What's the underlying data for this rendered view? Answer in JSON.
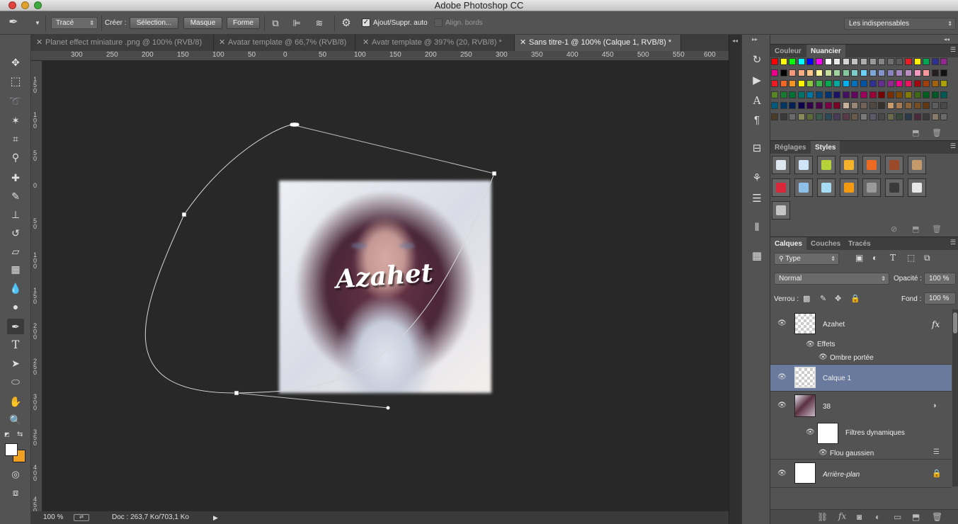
{
  "app": {
    "title": "Adobe Photoshop CC"
  },
  "options": {
    "tool_mode": "Tracé",
    "create_label": "Créer :",
    "selection_btn": "Sélection...",
    "mask_btn": "Masque",
    "shape_btn": "Forme",
    "auto_add": "Ajout/Suppr. auto",
    "align_edges": "Align. bords",
    "workspace": "Les indispensables"
  },
  "tabs": [
    {
      "label": "Planet effect miniature .png @ 100% (RVB/8)"
    },
    {
      "label": "Avatar template @ 66,7% (RVB/8)"
    },
    {
      "label": "Avatr template @ 397% (20, RVB/8) *"
    },
    {
      "label": "Sans titre-1 @ 100% (Calque 1, RVB/8) *"
    }
  ],
  "ruler": {
    "top": [
      "300",
      "250",
      "200",
      "150",
      "100",
      "50",
      "0",
      "50",
      "100",
      "150",
      "200",
      "250",
      "300",
      "350",
      "400",
      "450",
      "500",
      "550",
      "600"
    ],
    "left": [
      "150",
      "100",
      "50",
      "0",
      "50",
      "100",
      "150",
      "200",
      "250",
      "300",
      "350",
      "400",
      "450"
    ]
  },
  "canvas": {
    "watermark": "Azahet"
  },
  "status": {
    "zoom": "100 %",
    "doc": "Doc : 263,7 Ko/703,1 Ko"
  },
  "panels": {
    "color_tab": "Couleur",
    "swatches_tab": "Nuancier",
    "adjust_tab": "Réglages",
    "styles_tab": "Styles",
    "layers_tab": "Calques",
    "channels_tab": "Couches",
    "paths_tab": "Tracés"
  },
  "layers": {
    "filter_kind": "Type",
    "blend_mode": "Normal",
    "opacity_label": "Opacité :",
    "opacity": "100 %",
    "lock_label": "Verrou :",
    "fill_label": "Fond :",
    "fill": "100 %",
    "items": [
      {
        "name": "Azahet",
        "fx": "fx",
        "effects": "Effets",
        "effect1": "Ombre portée"
      },
      {
        "name": "Calque 1"
      },
      {
        "name": "38",
        "smart_filters": "Filtres dynamiques",
        "filter1": "Flou gaussien"
      },
      {
        "name": "Arrière-plan"
      }
    ]
  },
  "colors": {
    "accent": "#f0a020",
    "selected_layer": "#6a7a9c",
    "ui_bg": "#535353",
    "canvas_bg": "#282828"
  },
  "icons": [
    "pen-icon",
    "move-icon",
    "marquee-icon",
    "lasso-icon",
    "magic-wand-icon",
    "crop-icon",
    "eyedropper-icon",
    "healing-icon",
    "brush-icon",
    "stamp-icon",
    "history-brush-icon",
    "eraser-icon",
    "gradient-icon",
    "blur-icon",
    "dodge-icon",
    "type-icon",
    "path-select-icon",
    "ellipse-icon",
    "hand-icon",
    "zoom-icon",
    "eye-icon",
    "lock-icon",
    "gear-icon"
  ]
}
